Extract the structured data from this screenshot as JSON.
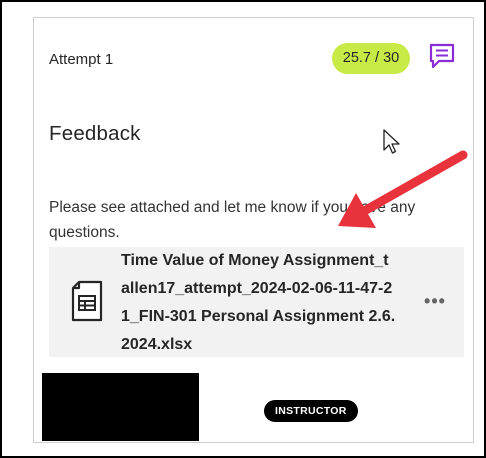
{
  "attempt": {
    "label": "Attempt 1"
  },
  "grade": {
    "score": "25.7",
    "separator": " / ",
    "total": "30",
    "pill_color": "#c7ea46"
  },
  "feedback": {
    "title": "Feedback",
    "message": "Please see attached and let me know if you have any questions.",
    "icon": "feedback-comment-icon",
    "accent_color": "#8a2bd6"
  },
  "attachment": {
    "file_name": "Time Value of Money Assignment_tallen17_attempt_2024-02-06-11-47-21_FIN-301 Personal Assignment 2.6.2024.xlsx",
    "icon": "spreadsheet-file-icon",
    "menu_icon": "more-options-icon"
  },
  "author": {
    "role_badge": "INSTRUCTOR"
  },
  "annotation": {
    "arrow_color": "#e8323c"
  }
}
